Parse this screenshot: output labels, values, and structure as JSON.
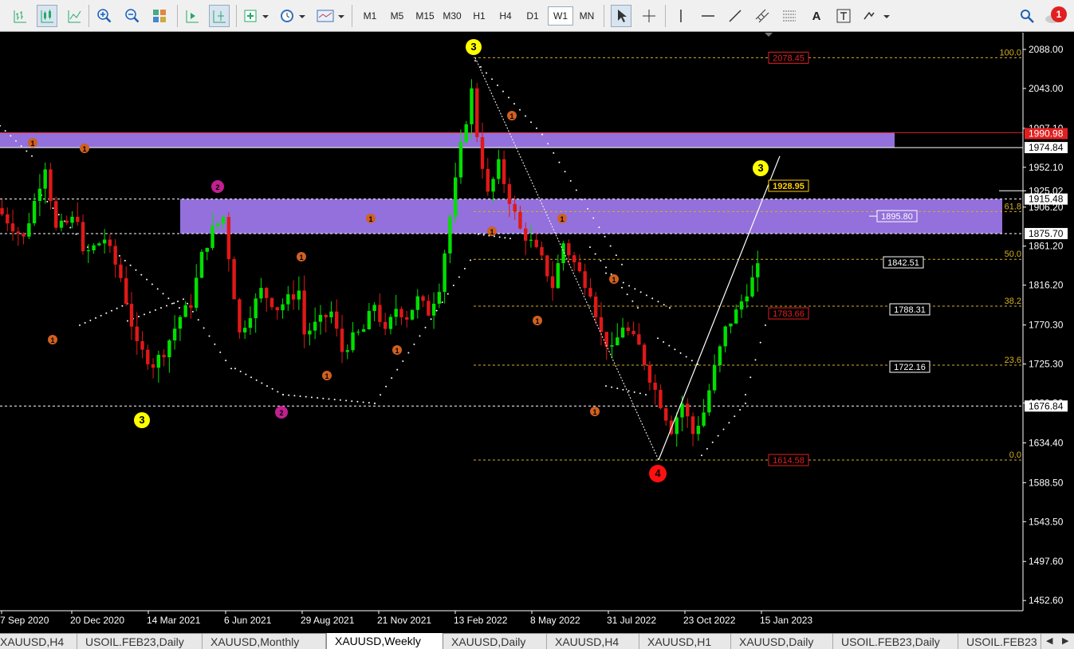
{
  "toolbar": {
    "timeframes": [
      "M1",
      "M5",
      "M15",
      "M30",
      "H1",
      "H4",
      "D1",
      "W1",
      "MN"
    ],
    "active_timeframe": "W1",
    "alert_count": "1",
    "text_tool_label": "A"
  },
  "chart": {
    "symbol": "XAUUSD",
    "period": "Weekly",
    "price_axis_labels": [
      "2088.00",
      "2043.00",
      "1997.10",
      "1952.10",
      "1925.02",
      "1906.20",
      "1861.20",
      "1816.20",
      "1770.30",
      "1725.30",
      "1680.30",
      "1634.40",
      "1588.50",
      "1543.50",
      "1497.60",
      "1452.60"
    ],
    "time_axis_labels": [
      "7 Sep 2020",
      "20 Dec 2020",
      "14 Mar 2021",
      "6 Jun 2021",
      "29 Aug 2021",
      "21 Nov 2021",
      "13 Feb 2022",
      "8 May 2022",
      "31 Jul 2022",
      "23 Oct 2022",
      "15 Jan 2023"
    ],
    "axis_price_tags": [
      {
        "text": "1990.98",
        "price": 1990.98,
        "style": "red"
      },
      {
        "text": "1974.84",
        "price": 1974.84,
        "style": "white"
      },
      {
        "text": "1915.48",
        "price": 1915.48,
        "style": "white"
      },
      {
        "text": "1875.70",
        "price": 1875.7,
        "style": "white"
      },
      {
        "text": "1676.84",
        "price": 1676.84,
        "style": "white"
      }
    ],
    "fibonacci_levels": [
      {
        "ratio": "100.0",
        "price": 2078.45
      },
      {
        "ratio": "61.8",
        "price": 1901.0
      },
      {
        "ratio": "50.0",
        "price": 1846.0
      },
      {
        "ratio": "38.2",
        "price": 1792.0
      },
      {
        "ratio": "23.6",
        "price": 1724.0
      },
      {
        "ratio": "0.0",
        "price": 1614.58
      }
    ],
    "price_callouts": [
      {
        "text": "2078.45",
        "style": "red"
      },
      {
        "text": "1928.95",
        "style": "yellow"
      },
      {
        "text": "1895.80",
        "style": "purple"
      },
      {
        "text": "1842.51",
        "style": "white"
      },
      {
        "text": "1788.31",
        "style": "white"
      },
      {
        "text": "1783.66",
        "style": "red"
      },
      {
        "text": "1722.16",
        "style": "white"
      },
      {
        "text": "1614.58",
        "style": "red"
      }
    ],
    "supply_zones": [
      {
        "price_top": 1992.0,
        "price_bottom": 1974.84
      },
      {
        "price_top": 1915.48,
        "price_bottom": 1875.7
      }
    ],
    "wave_labels": [
      {
        "text": "3",
        "color": "yellow"
      },
      {
        "text": "3",
        "color": "yellow"
      },
      {
        "text": "3",
        "color": "yellow"
      },
      {
        "text": "4",
        "color": "red"
      },
      {
        "text": "2",
        "color": "magenta"
      },
      {
        "text": "2",
        "color": "magenta"
      },
      {
        "text": "1",
        "color": "orange"
      }
    ],
    "colors": {
      "bull": "#00e000",
      "bear": "#e01818",
      "zone": "#9370db",
      "fib": "#d4b020",
      "grid_dots": "#ffffff"
    }
  },
  "tabs": {
    "items": [
      "XAUUSD,H4",
      "USOIL.FEB23,Daily",
      "XAUUSD,Monthly",
      "XAUUSD,Weekly",
      "XAUUSD,Daily",
      "XAUUSD,H4",
      "XAUUSD,H1",
      "XAUUSD,Daily",
      "USOIL.FEB23,Daily",
      "USOIL.FEB23"
    ],
    "active_index": 3
  }
}
